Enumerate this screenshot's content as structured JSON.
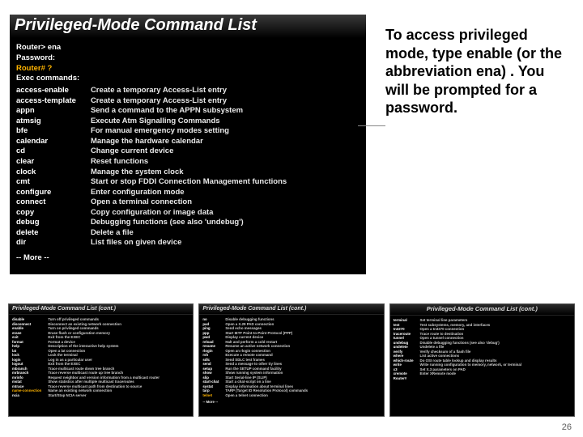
{
  "main": {
    "title": "Privileged-Mode Command List",
    "prompts": [
      {
        "text": "Router> ena",
        "orange": false
      },
      {
        "text": "Password:",
        "orange": false
      },
      {
        "text": "Router# ?",
        "orange": true
      },
      {
        "text": "Exec commands:",
        "orange": false
      }
    ],
    "commands": [
      {
        "name": "access-enable",
        "desc": "Create a temporary Access-List entry"
      },
      {
        "name": "access-template",
        "desc": "Create a temporary Access-List entry"
      },
      {
        "name": "appn",
        "desc": "Send a command to the APPN subsystem"
      },
      {
        "name": "atmsig",
        "desc": "Execute Atm Signalling Commands"
      },
      {
        "name": "bfe",
        "desc": "For manual emergency modes setting"
      },
      {
        "name": "calendar",
        "desc": "Manage the hardware calendar"
      },
      {
        "name": "cd",
        "desc": "Change current device"
      },
      {
        "name": "clear",
        "desc": "Reset functions"
      },
      {
        "name": "clock",
        "desc": "Manage the system clock"
      },
      {
        "name": "cmt",
        "desc": "Start or stop FDDI Connection Management functions"
      },
      {
        "name": "configure",
        "desc": "Enter configuration mode"
      },
      {
        "name": "connect",
        "desc": "Open a terminal connection"
      },
      {
        "name": "copy",
        "desc": "Copy configuration or image data"
      },
      {
        "name": "debug",
        "desc": "Debugging functions (see also 'undebug')"
      },
      {
        "name": "delete",
        "desc": "Delete a file"
      },
      {
        "name": "dir",
        "desc": "List files on given device"
      }
    ],
    "more": "-- More --"
  },
  "side_note": "To access privileged mode, type enable (or the abbreviation ena) . You will be prompted for a password.",
  "thumbs": [
    {
      "title": "Privileged-Mode Command List (cont.)",
      "commands": [
        {
          "name": "disable",
          "desc": "Turn off privileged commands"
        },
        {
          "name": "disconnect",
          "desc": "Disconnect an existing network connection"
        },
        {
          "name": "enable",
          "desc": "Turn on privileged commands"
        },
        {
          "name": "erase",
          "desc": "Erase flash or configuration memory"
        },
        {
          "name": "exit",
          "desc": "Exit from the EXEC"
        },
        {
          "name": "format",
          "desc": "Format a device"
        },
        {
          "name": "help",
          "desc": "Description of the interactive help system"
        },
        {
          "name": "lat",
          "desc": "Open a lat connection"
        },
        {
          "name": "lock",
          "desc": "Lock the terminal"
        },
        {
          "name": "login",
          "desc": "Log in as a particular user"
        },
        {
          "name": "logout",
          "desc": "Exit from the EXEC"
        },
        {
          "name": "mbranch",
          "desc": "Trace multicast route down tree branch"
        },
        {
          "name": "mrbranch",
          "desc": "Trace reverse multicast route up tree branch"
        },
        {
          "name": "mrinfo",
          "desc": "Request neighbor and version information from a multicast router"
        },
        {
          "name": "mstat",
          "desc": "Show statistics after multiple multicast traceroutes"
        },
        {
          "name": "mtrace",
          "desc": "Trace reverse multicast path from destination to source"
        }
      ],
      "hl": {
        "name": "name-connection",
        "desc": "Name an existing network connection"
      },
      "tail": [
        {
          "name": "ncia",
          "desc": "Start/Stop NCIA server"
        }
      ]
    },
    {
      "title": "Privileged-Mode Command List (cont.)",
      "commands": [
        {
          "name": "no",
          "desc": "Disable debugging functions"
        },
        {
          "name": "pad",
          "desc": "Open a X.29 PAD connection"
        },
        {
          "name": "ping",
          "desc": "Send echo messages"
        },
        {
          "name": "ppp",
          "desc": "Start IETF Point-to-Point Protocol (PPP)"
        },
        {
          "name": "pwd",
          "desc": "Display current device"
        },
        {
          "name": "reload",
          "desc": "Halt and perform a cold restart"
        },
        {
          "name": "resume",
          "desc": "Resume an active network connection"
        },
        {
          "name": "rlogin",
          "desc": "Open an rlogin connection"
        },
        {
          "name": "rsh",
          "desc": "Execute a remote command"
        },
        {
          "name": "sdlc",
          "desc": "Send SDLC test frames"
        },
        {
          "name": "send",
          "desc": "Send a message to other tty lines"
        },
        {
          "name": "setup",
          "desc": "Run the SETUP command facility"
        },
        {
          "name": "show",
          "desc": "Show running system information"
        },
        {
          "name": "slip",
          "desc": "Start Serial-line IP (SLIP)"
        },
        {
          "name": "start-chat",
          "desc": "Start a chat-script on a line"
        },
        {
          "name": "systat",
          "desc": "Display information about terminal lines"
        },
        {
          "name": "tarp",
          "desc": "TARP (Target ID Resolution Protocol) commands"
        }
      ],
      "hl": {
        "name": "telnet",
        "desc": "Open a telnet connection"
      },
      "tail": [],
      "more": "-- More --"
    },
    {
      "title": "Privileged-Mode Command List (cont.)",
      "commands": [
        {
          "name": "terminal",
          "desc": "Set terminal line parameters"
        },
        {
          "name": "test",
          "desc": "Test subsystems, memory, and interfaces"
        },
        {
          "name": "tn3270",
          "desc": "Open a tn3270 connection"
        },
        {
          "name": "traceroute",
          "desc": "Trace route to destination"
        },
        {
          "name": "tunnel",
          "desc": "Open a tunnel connection"
        },
        {
          "name": "undebug",
          "desc": "Disable debugging functions (see also 'debug')"
        },
        {
          "name": "undelete",
          "desc": "Undelete a file"
        },
        {
          "name": "verify",
          "desc": "Verify checksum of a flash file"
        },
        {
          "name": "where",
          "desc": "List active connections"
        },
        {
          "name": "which-route",
          "desc": "Do OSI route table lookup and display results"
        },
        {
          "name": "write",
          "desc": "Write running configuration to memory, network, or terminal"
        },
        {
          "name": "x3",
          "desc": "Set X.3 parameters on PAD"
        },
        {
          "name": "xremote",
          "desc": "Enter XRemote mode"
        },
        {
          "name": "Router#",
          "desc": ""
        }
      ]
    }
  ],
  "slide_number": "26"
}
